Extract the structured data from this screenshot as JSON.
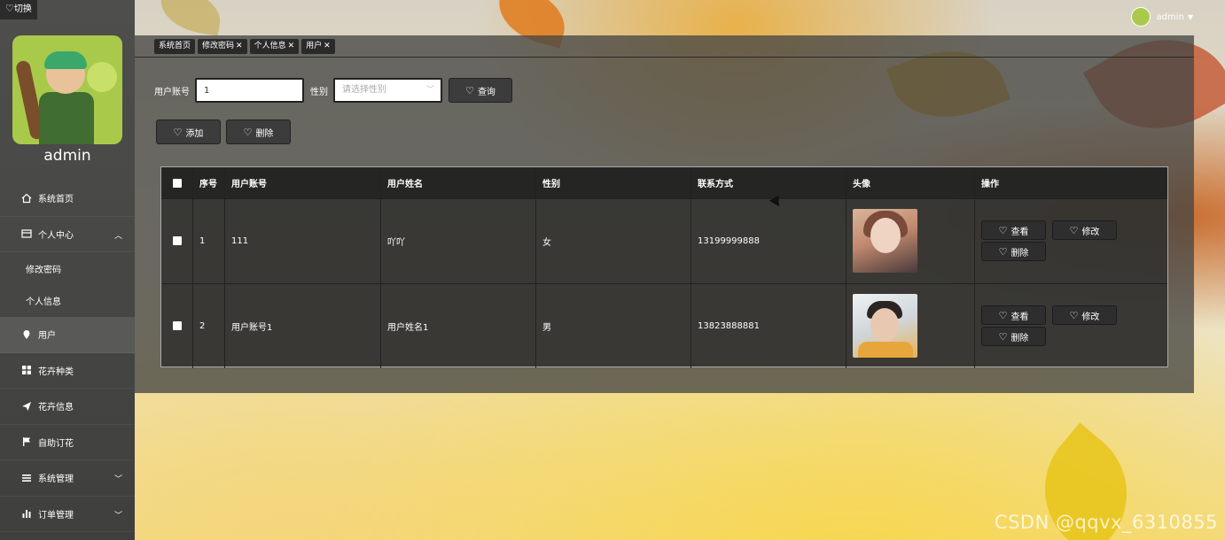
{
  "sidebar": {
    "switch_label": "切换",
    "username": "admin",
    "items": [
      {
        "label": "系统首页",
        "icon": "home-icon"
      },
      {
        "label": "个人中心",
        "icon": "card-icon",
        "expanded": true,
        "children": [
          {
            "label": "修改密码"
          },
          {
            "label": "个人信息"
          }
        ]
      },
      {
        "label": "用户",
        "icon": "location-pin-icon",
        "active": true
      },
      {
        "label": "花卉种类",
        "icon": "grid-icon"
      },
      {
        "label": "花卉信息",
        "icon": "send-icon"
      },
      {
        "label": "自助订花",
        "icon": "flag-icon"
      },
      {
        "label": "系统管理",
        "icon": "list-icon"
      },
      {
        "label": "订单管理",
        "icon": "bar-chart-icon"
      }
    ]
  },
  "topbar": {
    "username": "admin"
  },
  "tabs": [
    {
      "label": "系统首页",
      "closable": false
    },
    {
      "label": "修改密码",
      "closable": true
    },
    {
      "label": "个人信息",
      "closable": true
    },
    {
      "label": "用户",
      "closable": true
    }
  ],
  "search": {
    "account_label": "用户账号",
    "account_value": "1",
    "gender_label": "性别",
    "gender_placeholder": "请选择性别",
    "query_button": "查询"
  },
  "actions": {
    "add": "添加",
    "delete": "删除"
  },
  "table": {
    "columns": [
      "序号",
      "用户账号",
      "用户姓名",
      "性别",
      "联系方式",
      "头像",
      "操作"
    ],
    "rows": [
      {
        "index": "1",
        "account": "111",
        "name": "吖吖",
        "gender": "女",
        "phone": "13199999888"
      },
      {
        "index": "2",
        "account": "用户账号1",
        "name": "用户姓名1",
        "gender": "男",
        "phone": "13823888881"
      }
    ],
    "row_actions": {
      "view": "查看",
      "edit": "修改",
      "delete": "删除"
    }
  },
  "watermark": "CSDN @qqvx_6310855",
  "colors": {
    "sidebar": "#4e4e4c",
    "panel": "#464644",
    "button": "#3c3c3c"
  }
}
